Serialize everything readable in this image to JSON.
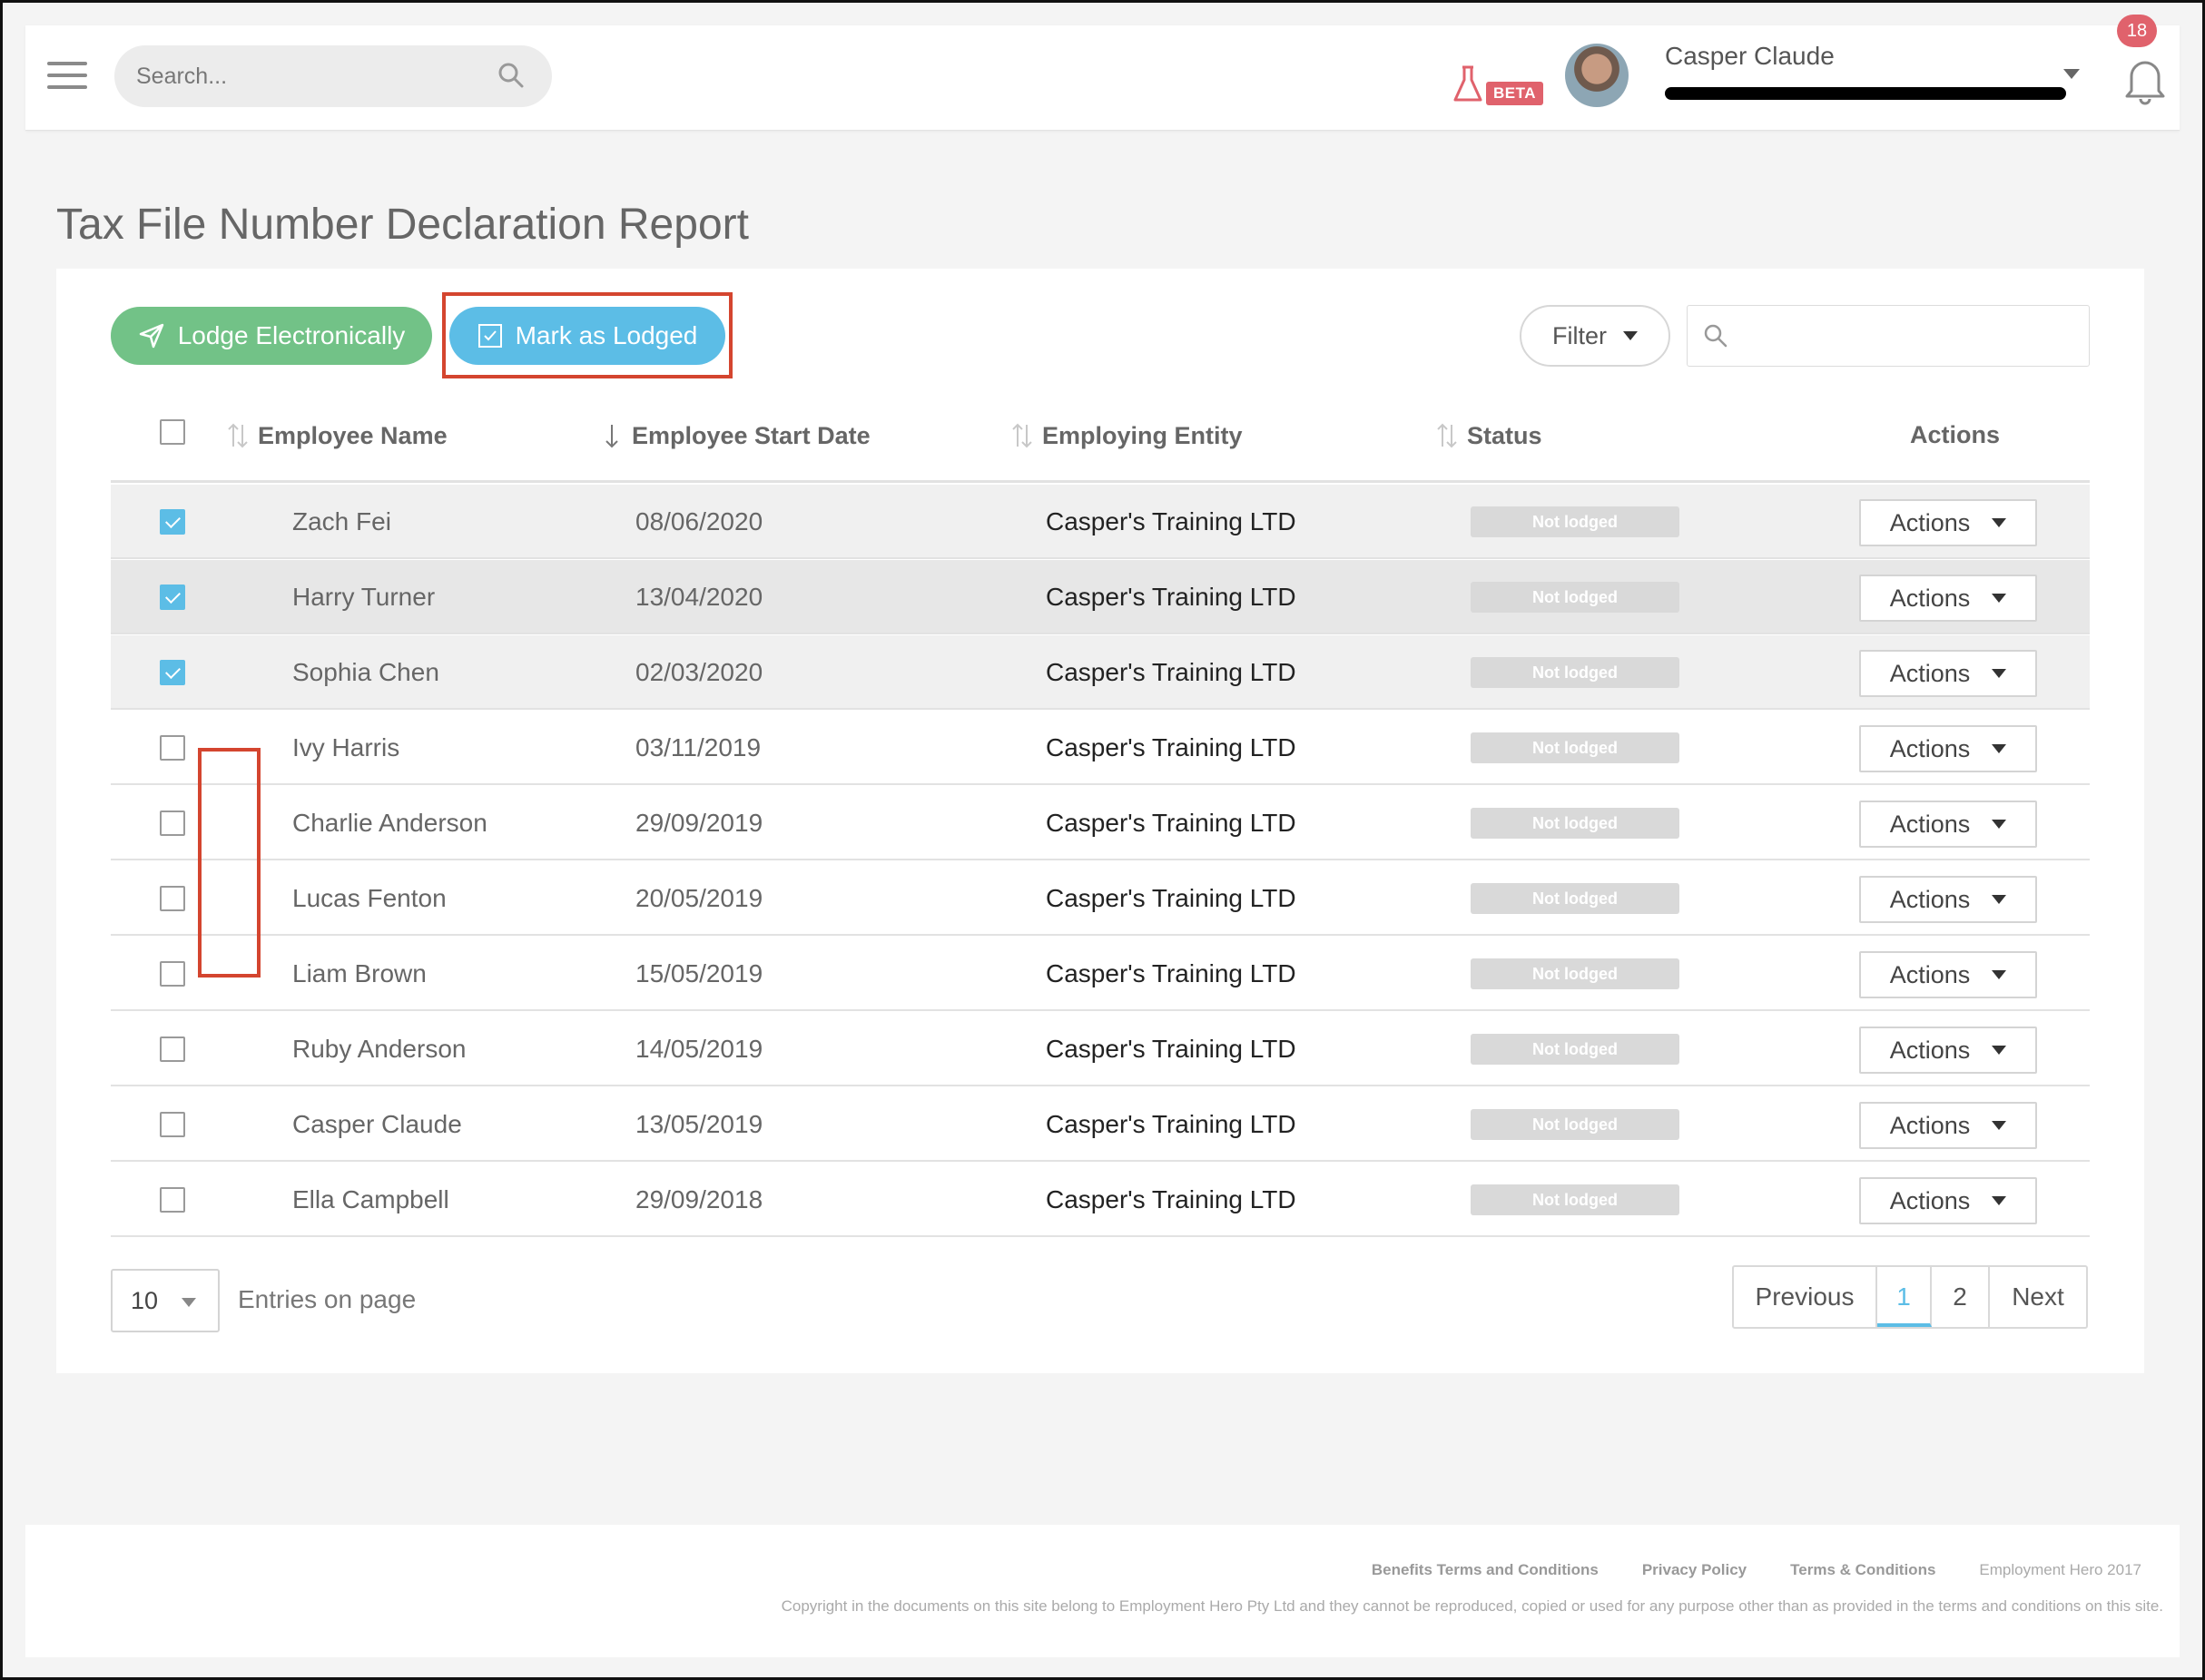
{
  "header": {
    "search_placeholder": "Search...",
    "beta_label": "BETA",
    "user_name": "Casper Claude",
    "notification_count": "18"
  },
  "page": {
    "title": "Tax File Number Declaration Report"
  },
  "toolbar": {
    "lodge_label": "Lodge Electronically",
    "mark_label": "Mark as Lodged",
    "filter_label": "Filter"
  },
  "table": {
    "columns": {
      "name": "Employee Name",
      "start_date": "Employee Start Date",
      "entity": "Employing Entity",
      "status": "Status",
      "actions": "Actions"
    },
    "rows": [
      {
        "name": "Zach Fei",
        "date": "08/06/2020",
        "entity": "Casper's Training LTD",
        "status": "Not lodged",
        "action": "Actions",
        "checked": true
      },
      {
        "name": "Harry Turner",
        "date": "13/04/2020",
        "entity": "Casper's Training LTD",
        "status": "Not lodged",
        "action": "Actions",
        "checked": true
      },
      {
        "name": "Sophia Chen",
        "date": "02/03/2020",
        "entity": "Casper's Training LTD",
        "status": "Not lodged",
        "action": "Actions",
        "checked": true
      },
      {
        "name": "Ivy Harris",
        "date": "03/11/2019",
        "entity": "Casper's Training LTD",
        "status": "Not lodged",
        "action": "Actions",
        "checked": false
      },
      {
        "name": "Charlie Anderson",
        "date": "29/09/2019",
        "entity": "Casper's Training LTD",
        "status": "Not lodged",
        "action": "Actions",
        "checked": false
      },
      {
        "name": "Lucas Fenton",
        "date": "20/05/2019",
        "entity": "Casper's Training LTD",
        "status": "Not lodged",
        "action": "Actions",
        "checked": false
      },
      {
        "name": "Liam Brown",
        "date": "15/05/2019",
        "entity": "Casper's Training LTD",
        "status": "Not lodged",
        "action": "Actions",
        "checked": false
      },
      {
        "name": "Ruby Anderson",
        "date": "14/05/2019",
        "entity": "Casper's Training LTD",
        "status": "Not lodged",
        "action": "Actions",
        "checked": false
      },
      {
        "name": "Casper Claude",
        "date": "13/05/2019",
        "entity": "Casper's Training LTD",
        "status": "Not lodged",
        "action": "Actions",
        "checked": false
      },
      {
        "name": "Ella Campbell",
        "date": "29/09/2018",
        "entity": "Casper's Training LTD",
        "status": "Not lodged",
        "action": "Actions",
        "checked": false
      }
    ]
  },
  "pagination": {
    "entries_value": "10",
    "entries_label": "Entries on page",
    "previous": "Previous",
    "page1": "1",
    "page2": "2",
    "next": "Next"
  },
  "footer": {
    "benefits": "Benefits Terms and Conditions",
    "privacy": "Privacy Policy",
    "terms": "Terms & Conditions",
    "brand": "Employment Hero 2017",
    "copyright": "Copyright in the documents on this site belong to Employment Hero Pty Ltd and they cannot be reproduced, copied or used for any purpose other than as provided in the terms and conditions on this site."
  },
  "colors": {
    "accent_blue": "#5cbde6",
    "lodge_green": "#72c287",
    "highlight_red": "#d4452f",
    "badge_red": "#e0626c"
  }
}
